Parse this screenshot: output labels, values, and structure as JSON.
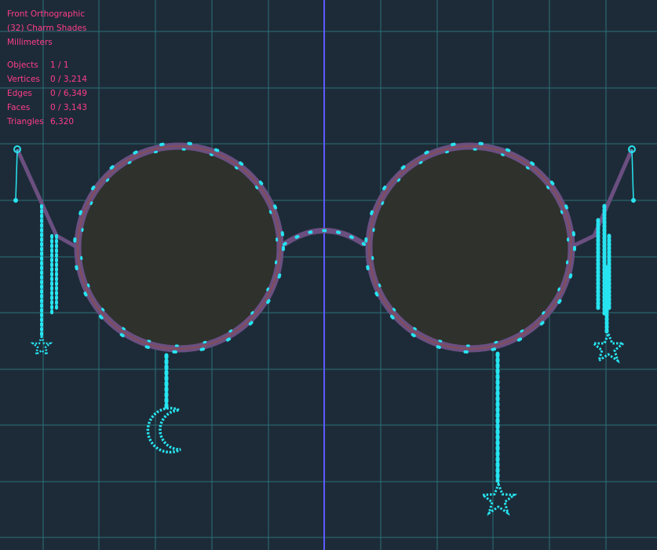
{
  "viewport_header": {
    "view_name": "Front Orthographic",
    "object_name": "(32) Charm Shades",
    "units": "Millimeters"
  },
  "stats": [
    {
      "label": "Objects",
      "value": "1 / 1"
    },
    {
      "label": "Vertices",
      "value": "0 / 3,214"
    },
    {
      "label": "Edges",
      "value": "0 / 6,349"
    },
    {
      "label": "Faces",
      "value": "0 / 3,143"
    },
    {
      "label": "Triangles",
      "value": "6,320"
    }
  ],
  "colors": {
    "background": "#1d2b38",
    "grid": "#2e7f84",
    "z_axis": "#5a5aff",
    "overlay_text": "#ff3d8b",
    "vertex": "#27e4f0",
    "frame": "#6a4f80",
    "lens": "#2f312d"
  },
  "object": {
    "name_icon": "glasses-mesh",
    "charms": [
      "moon-charm-icon",
      "star-charm-icon",
      "star-charm-icon",
      "star-charm-icon"
    ]
  }
}
